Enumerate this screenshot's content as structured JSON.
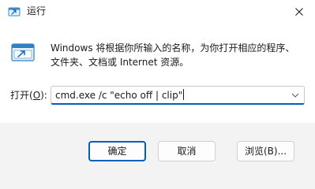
{
  "window": {
    "title": "运行",
    "close_icon": "close-icon"
  },
  "content": {
    "icon": "run-dialog-icon",
    "description": "Windows 将根据你所输入的名称，为你打开相应的程序、文件夹、文档或 Internet 资源。",
    "open_label_prefix": "打开(",
    "open_label_accel": "O",
    "open_label_suffix": "):",
    "command_value": "cmd.exe /c \"echo off | clip\""
  },
  "buttons": {
    "ok": "确定",
    "cancel": "取消",
    "browse": "浏览(B)..."
  },
  "colors": {
    "accent": "#005fb8",
    "titlebar": "#ffffff",
    "footer": "#f3f3f3"
  }
}
